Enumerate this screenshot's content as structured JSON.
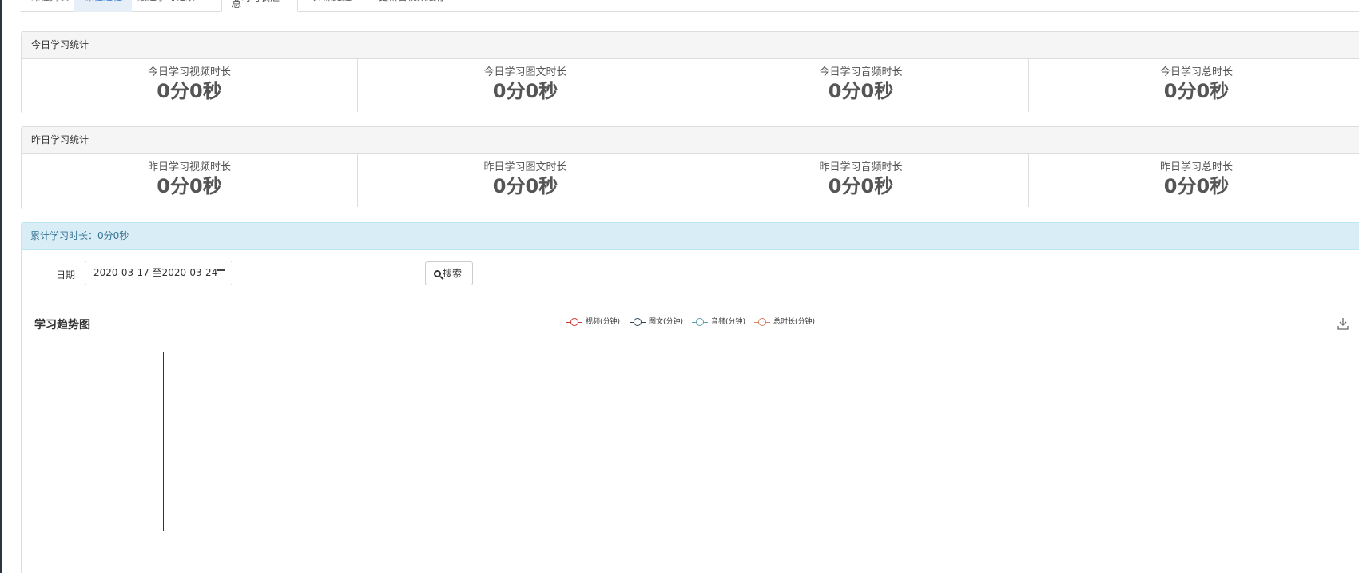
{
  "tabs": [
    {
      "label": "课程列表"
    },
    {
      "label": "课程进程"
    },
    {
      "label": "最近学习记录"
    },
    {
      "label": "学习时长汇总"
    },
    {
      "label": "开课提醒"
    },
    {
      "label": "更新音视频缓存"
    }
  ],
  "today": {
    "title": "今日学习统计",
    "stats": [
      {
        "label": "今日学习视频时长",
        "value": "0分0秒"
      },
      {
        "label": "今日学习图文时长",
        "value": "0分0秒"
      },
      {
        "label": "今日学习音频时长",
        "value": "0分0秒"
      },
      {
        "label": "今日学习总时长",
        "value": "0分0秒"
      }
    ]
  },
  "yesterday": {
    "title": "昨日学习统计",
    "stats": [
      {
        "label": "昨日学习视频时长",
        "value": "0分0秒"
      },
      {
        "label": "昨日学习图文时长",
        "value": "0分0秒"
      },
      {
        "label": "昨日学习音频时长",
        "value": "0分0秒"
      },
      {
        "label": "昨日学习总时长",
        "value": "0分0秒"
      }
    ]
  },
  "total": {
    "label": "累计学习时长：0分0秒"
  },
  "filter": {
    "date_label": "日期",
    "date_range": "2020-03-17 至2020-03-24",
    "search_label": "搜索"
  },
  "chart_data": {
    "type": "line",
    "title": "学习趋势图",
    "legend_position": "top-center",
    "series": [
      {
        "name": "视频(分钟)",
        "color": "#c23531",
        "values": []
      },
      {
        "name": "图文(分钟)",
        "color": "#2f4554",
        "values": []
      },
      {
        "name": "音频(分钟)",
        "color": "#61a0a8",
        "values": []
      },
      {
        "name": "总时长(分钟)",
        "color": "#d48265",
        "values": []
      }
    ],
    "x": [],
    "grid": false
  },
  "icons": {
    "calendar": "calendar-icon",
    "search": "search-icon",
    "download": "download-icon"
  }
}
